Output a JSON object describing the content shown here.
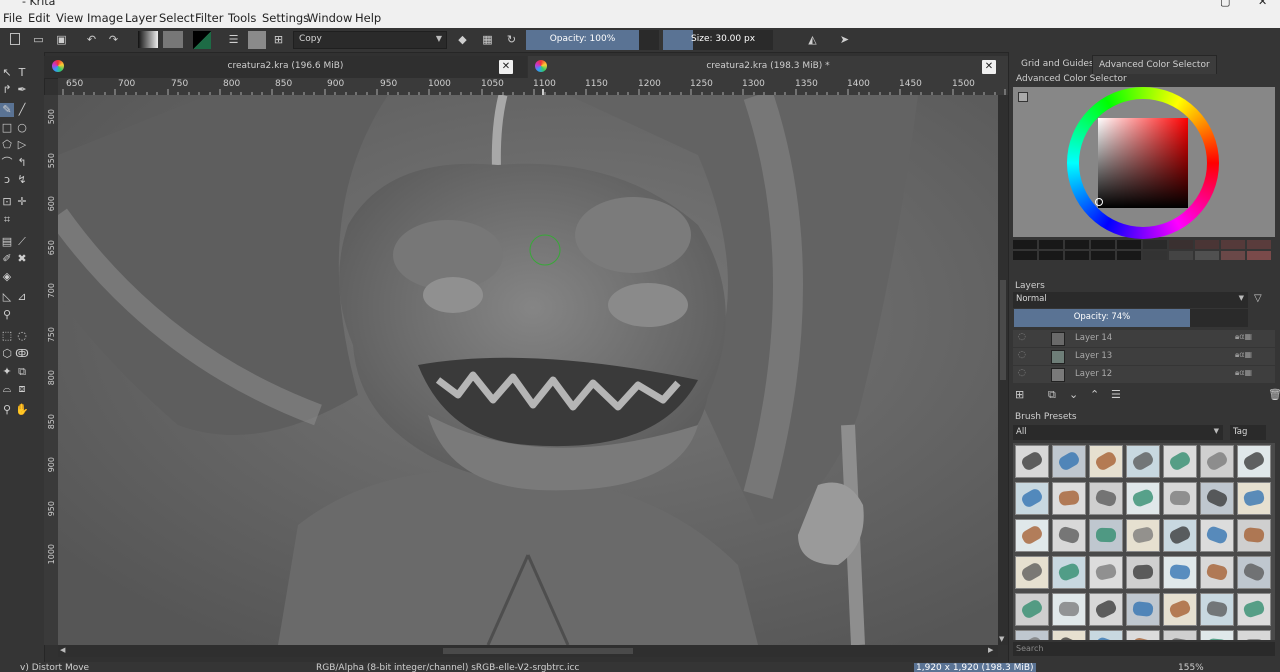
{
  "window": {
    "title": "- Krita",
    "icon": "krita-icon"
  },
  "menu": [
    "File",
    "Edit",
    "View",
    "Image",
    "Layer",
    "Select",
    "Filter",
    "Tools",
    "Settings",
    "Window",
    "Help"
  ],
  "toolbar": {
    "blend_mode": "Copy",
    "opacity_label": "Opacity: 100%",
    "size_label": "Size: 30.00 px"
  },
  "tabs": [
    {
      "label": "creatura2.kra (196.6 MiB)"
    },
    {
      "label": "creatura2.kra (198.3 MiB) *"
    }
  ],
  "rulers": {
    "horizontal": [
      "650",
      "700",
      "750",
      "800",
      "850",
      "900",
      "950",
      "1000",
      "1050",
      "1100",
      "1150",
      "1200",
      "1250",
      "1300",
      "1350",
      "1400",
      "1450",
      "1500"
    ],
    "vertical": [
      "500",
      "550",
      "600",
      "650",
      "700",
      "750",
      "800",
      "850",
      "900",
      "950",
      "1000"
    ]
  },
  "dock": {
    "tabs": [
      "Grid and Guides",
      "Advanced Color Selector"
    ],
    "color_selector_title": "Advanced Color Selector",
    "layers_title": "Layers",
    "layers_blend": "Normal",
    "layers_opacity": "Opacity:  74%",
    "layers": [
      {
        "name": "Layer 14"
      },
      {
        "name": "Layer 13"
      },
      {
        "name": "Layer 12"
      }
    ],
    "presets_title": "Brush Presets",
    "presets_filter": "All",
    "tag_label": "Tag",
    "search_placeholder": "Search"
  },
  "status": {
    "tool": "v) Distort Move",
    "color_space": "RGB/Alpha (8-bit integer/channel)  sRGB-elle-V2-srgbtrc.icc",
    "image_size": "1,920 x 1,920 (198.3 MiB)",
    "zoom": "155%"
  },
  "colors": {
    "accent": "#5a7394",
    "bg_dark": "#313131",
    "panel": "#353535",
    "menu_bg": "#f0f0f0"
  }
}
